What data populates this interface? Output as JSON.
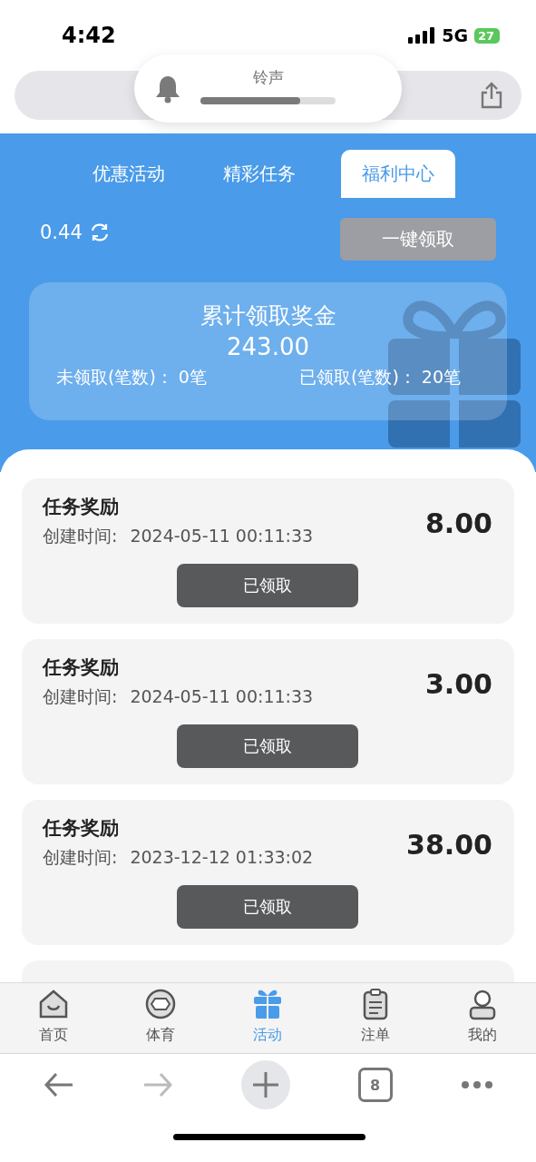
{
  "status_bar": {
    "time": "4:42",
    "network": "5G",
    "battery": "27"
  },
  "ringer_hud": {
    "label": "铃声",
    "level": 0.74
  },
  "tabs": [
    {
      "label": "优惠活动",
      "selected": false
    },
    {
      "label": "精彩任务",
      "selected": false
    },
    {
      "label": "福利中心",
      "selected": true
    }
  ],
  "balance": {
    "value": "0.44"
  },
  "claim_all_button": "一键领取",
  "summary": {
    "title": "累计领取奖金",
    "total": "243.00",
    "unclaimed": "未领取(笔数)： 0笔",
    "claimed": "已领取(笔数)： 20笔"
  },
  "records": [
    {
      "title": "任务奖励",
      "created_label": "创建时间:",
      "created": "2024-05-11 00:11:33",
      "amount": "8.00",
      "button": "已领取"
    },
    {
      "title": "任务奖励",
      "created_label": "创建时间:",
      "created": "2024-05-11 00:11:33",
      "amount": "3.00",
      "button": "已领取"
    },
    {
      "title": "任务奖励",
      "created_label": "创建时间:",
      "created": "2023-12-12 01:33:02",
      "amount": "38.00",
      "button": "已领取"
    }
  ],
  "bottom_nav": [
    {
      "label": "首页",
      "kind": "home",
      "selected": false
    },
    {
      "label": "体育",
      "kind": "ball",
      "selected": false
    },
    {
      "label": "活动",
      "kind": "gift",
      "selected": true
    },
    {
      "label": "注单",
      "kind": "clipboard",
      "selected": false
    },
    {
      "label": "我的",
      "kind": "person",
      "selected": false
    }
  ],
  "browser_toolbar": {
    "tab_count": "8"
  }
}
